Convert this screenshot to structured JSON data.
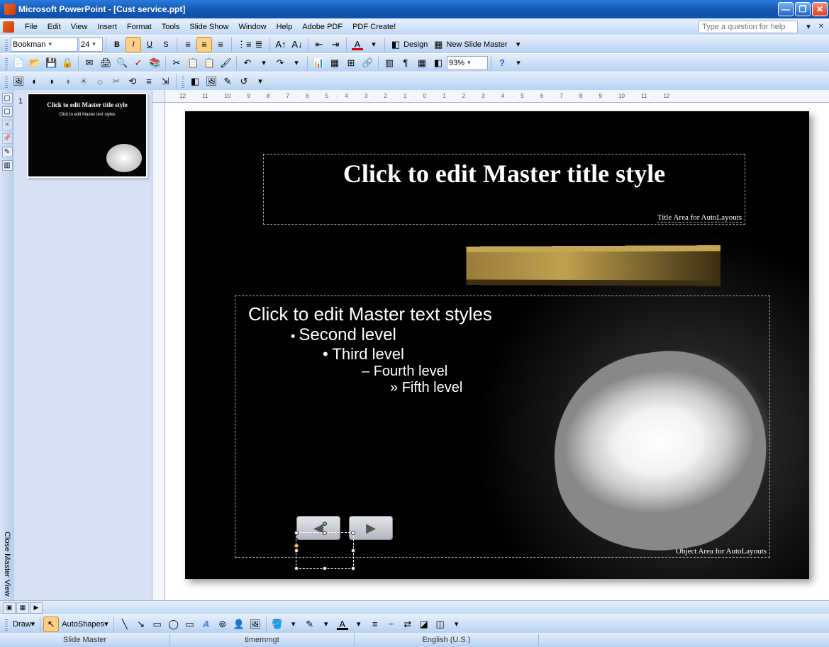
{
  "titlebar": {
    "text": "Microsoft PowerPoint - [Cust service.ppt]"
  },
  "menu": {
    "items": [
      "File",
      "Edit",
      "View",
      "Insert",
      "Format",
      "Tools",
      "Slide Show",
      "Window",
      "Help",
      "Adobe PDF",
      "PDF Create!"
    ],
    "question_placeholder": "Type a question for help"
  },
  "formatting": {
    "font": "Bookman",
    "size": "24",
    "bold": "B",
    "italic": "I",
    "underline": "U",
    "shadow": "S",
    "design_label": "Design",
    "new_master_label": "New Slide Master"
  },
  "standard": {
    "zoom": "93%"
  },
  "slide": {
    "number": "1",
    "title": "Click to edit Master title style",
    "title_caption": "Title Area for AutoLayouts",
    "body_l1": "Click to edit Master text styles",
    "body_l2": "Second level",
    "body_l3": "Third level",
    "body_l4": "Fourth level",
    "body_l5": "Fifth level",
    "body_caption": "Object Area for AutoLayouts"
  },
  "thumb": {
    "title": "Click to edit Master title style",
    "body": "Click to edit Master text styles"
  },
  "sidebar_mv": {
    "close_label": "Close Master View"
  },
  "drawing": {
    "draw_label": "Draw",
    "autoshapes_label": "AutoShapes"
  },
  "status": {
    "mode": "Slide Master",
    "template": "timemmgt",
    "language": "English (U.S.)"
  },
  "ruler": "12 · 11 · 10 · 9 · 8 · 7 · 6 · 5 · 4 · 3 · 2 · 1 · 0 · 1 · 2 · 3 · 4 · 5 · 6 · 7 · 8 · 9 · 10 · 11 · 12"
}
